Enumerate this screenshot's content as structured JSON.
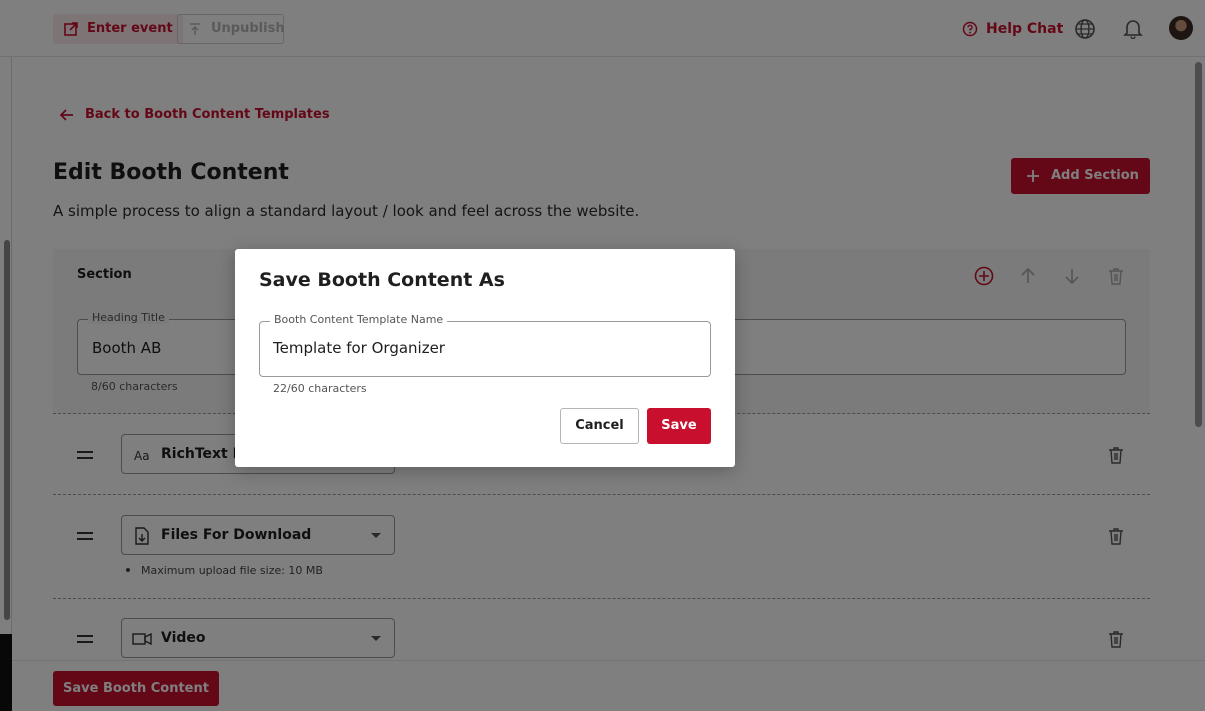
{
  "topbar": {
    "enter_event": "Enter event",
    "unpublish": "Unpublish",
    "help_chat": "Help Chat"
  },
  "page": {
    "back_link": "Back to Booth Content Templates",
    "title": "Edit Booth Content",
    "subtitle": "A simple process to align a standard layout / look and feel across the website.",
    "add_section": "Add Section",
    "save_booth_content": "Save Booth Content"
  },
  "section": {
    "label": "Section",
    "heading_label": "Heading Title",
    "heading_value": "Booth AB",
    "heading_count": "8/60 characters",
    "blocks": [
      {
        "type": "RichText Editor",
        "visible_text": "RichText Ed",
        "icon": "text-format-icon"
      },
      {
        "type": "Files For Download",
        "icon": "file-download-icon",
        "hint": "Maximum upload file size: 10 MB"
      },
      {
        "type": "Video",
        "icon": "video-icon"
      }
    ]
  },
  "modal": {
    "title": "Save Booth Content As",
    "field_label": "Booth Content Template Name",
    "field_value": "Template for Organizer",
    "char_count": "22/60 characters",
    "cancel": "Cancel",
    "save": "Save"
  },
  "colors": {
    "accent": "#c8102e",
    "overlay": "rgba(0,0,0,0.5)"
  }
}
